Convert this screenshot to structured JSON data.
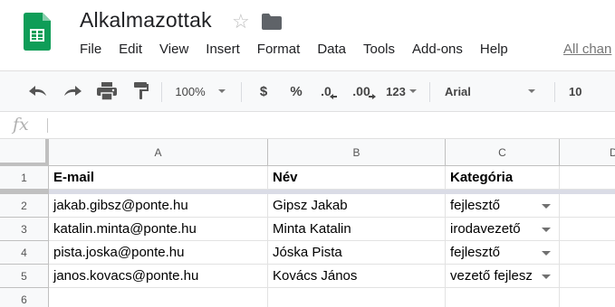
{
  "app": {
    "title": "Alkalmazottak",
    "all_changes": "All chan",
    "menu": [
      "File",
      "Edit",
      "View",
      "Insert",
      "Format",
      "Data",
      "Tools",
      "Add-ons",
      "Help"
    ]
  },
  "toolbar": {
    "zoom": "100%",
    "currency": "$",
    "percent": "%",
    "decrease_decimals": ".0",
    "increase_decimals": ".00",
    "more_formats": "123",
    "font": "Arial",
    "font_size": "10"
  },
  "formula": {
    "fx_label": "fx",
    "value": ""
  },
  "sheet": {
    "columns": [
      "A",
      "B",
      "C",
      "D"
    ],
    "rows": [
      "1",
      "2",
      "3",
      "4",
      "5",
      "6"
    ],
    "header": [
      "E-mail",
      "Név",
      "Kategória"
    ],
    "data": [
      [
        "jakab.gibsz@ponte.hu",
        "Gipsz Jakab",
        "fejlesztő"
      ],
      [
        "katalin.minta@ponte.hu",
        "Minta Katalin",
        "irodavezető"
      ],
      [
        "pista.joska@ponte.hu",
        "Jóska Pista",
        "fejlesztő"
      ],
      [
        "janos.kovacs@ponte.hu",
        "Kovács János",
        "vezető fejlesz"
      ]
    ]
  },
  "colors": {
    "logo_green": "#0f9d58",
    "toolbar_bg": "#f8f9fa",
    "freeze_bar": "#dadce6"
  }
}
